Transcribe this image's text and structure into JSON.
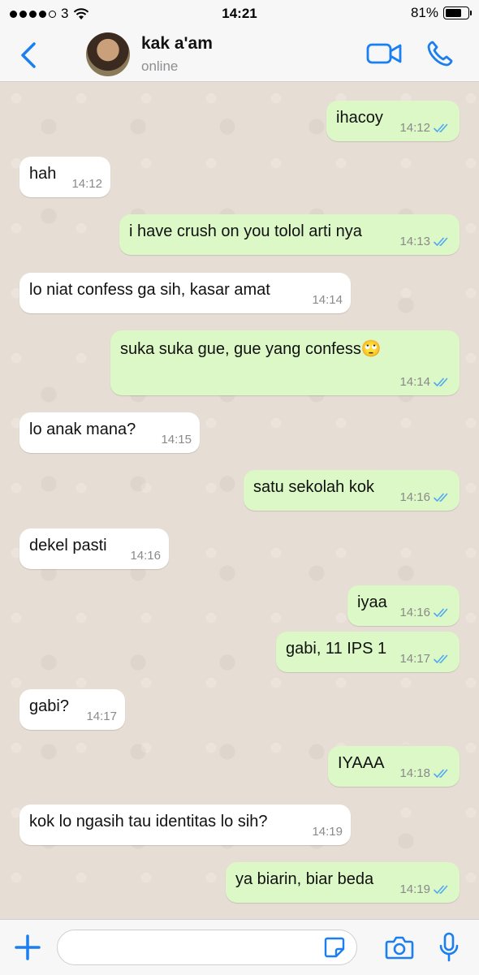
{
  "status_bar": {
    "carrier": "3",
    "time": "14:21",
    "battery": "81%",
    "battery_level": 0.81
  },
  "header": {
    "contact_name": "kak a'am",
    "contact_status": "online"
  },
  "messages": [
    {
      "direction": "out",
      "text": "ihacoy",
      "time": "14:12",
      "read": true
    },
    {
      "direction": "in",
      "text": "hah",
      "time": "14:12"
    },
    {
      "direction": "out",
      "text": "i have crush on you tolol arti nya",
      "time": "14:13",
      "read": true
    },
    {
      "direction": "in",
      "text": "lo niat confess ga sih, kasar amat",
      "time": "14:14"
    },
    {
      "direction": "out",
      "text": "suka suka gue, gue yang confess🙄",
      "time": "14:14",
      "read": true
    },
    {
      "direction": "in",
      "text": "lo anak mana?",
      "time": "14:15"
    },
    {
      "direction": "out",
      "text": "satu sekolah kok",
      "time": "14:16",
      "read": true
    },
    {
      "direction": "in",
      "text": "dekel pasti",
      "time": "14:16"
    },
    {
      "direction": "out",
      "text": "iyaa",
      "time": "14:16",
      "read": true
    },
    {
      "direction": "out",
      "text": "gabi, 11 IPS 1",
      "time": "14:17",
      "read": true
    },
    {
      "direction": "in",
      "text": "gabi?",
      "time": "14:17"
    },
    {
      "direction": "out",
      "text": "IYAAA",
      "time": "14:18",
      "read": true
    },
    {
      "direction": "in",
      "text": "kok lo ngasih tau identitas lo sih?",
      "time": "14:19"
    },
    {
      "direction": "out",
      "text": "ya biarin, biar beda",
      "time": "14:19",
      "read": true
    }
  ],
  "composer": {
    "value": "",
    "placeholder": ""
  },
  "colors": {
    "accent": "#1a7ff0",
    "outgoing_bubble": "#dcf8c6",
    "incoming_bubble": "#ffffff",
    "read_ticks": "#4fa8f0"
  },
  "icons": {
    "back": "chevron-left-icon",
    "video": "video-camera-icon",
    "call": "phone-icon",
    "plus": "plus-icon",
    "sticker": "sticker-icon",
    "camera": "camera-icon",
    "mic": "microphone-icon"
  }
}
